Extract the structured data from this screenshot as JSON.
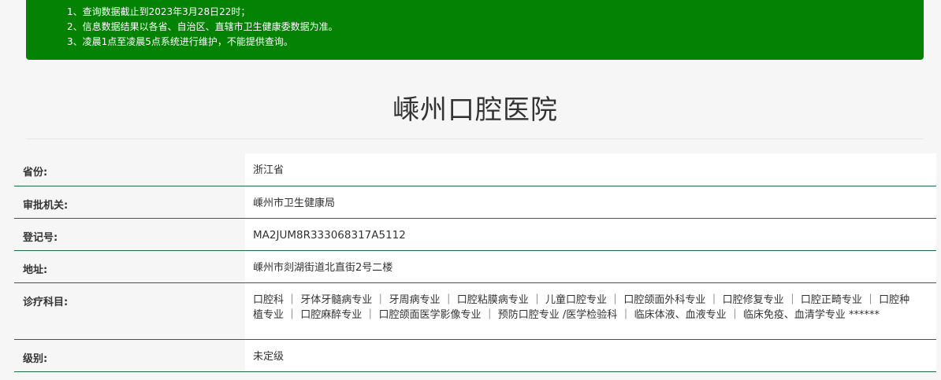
{
  "notice": {
    "lines": [
      "1、查询数据截止到2023年3月28日22时；",
      "2、信息数据结果以各省、自治区、直辖市卫生健康委数据为准。",
      "3、凌晨1点至凌晨5点系统进行维护，不能提供查询。"
    ]
  },
  "hospital": {
    "name": "嵊州口腔医院"
  },
  "details": {
    "province": {
      "label": "省份:",
      "value": "浙江省"
    },
    "authority": {
      "label": "审批机关:",
      "value": "嵊州市卫生健康局"
    },
    "registration": {
      "label": "登记号:",
      "value": "MA2JUM8R333068317A5112"
    },
    "address": {
      "label": "地址:",
      "value": "嵊州市剡湖街道北直街2号二楼"
    },
    "departments": {
      "label": "诊疗科目:",
      "value": "口腔科 ｜ 牙体牙髓病专业 ｜ 牙周病专业 ｜ 口腔粘膜病专业 ｜ 儿童口腔专业 ｜ 口腔颌面外科专业 ｜ 口腔修复专业 ｜ 口腔正畸专业 ｜ 口腔种植专业 ｜ 口腔麻醉专业 ｜ 口腔颌面医学影像专业 ｜ 预防口腔专业 /医学检验科 ｜ 临床体液、血液专业 ｜ 临床免疫、血清学专业 ******"
    },
    "level": {
      "label": "级别:",
      "value": "未定级"
    }
  },
  "colors": {
    "notice_background": "#048204",
    "row_divider": "#1e6b4a",
    "page_background": "#f6f6f6",
    "value_background": "#ffffff"
  }
}
